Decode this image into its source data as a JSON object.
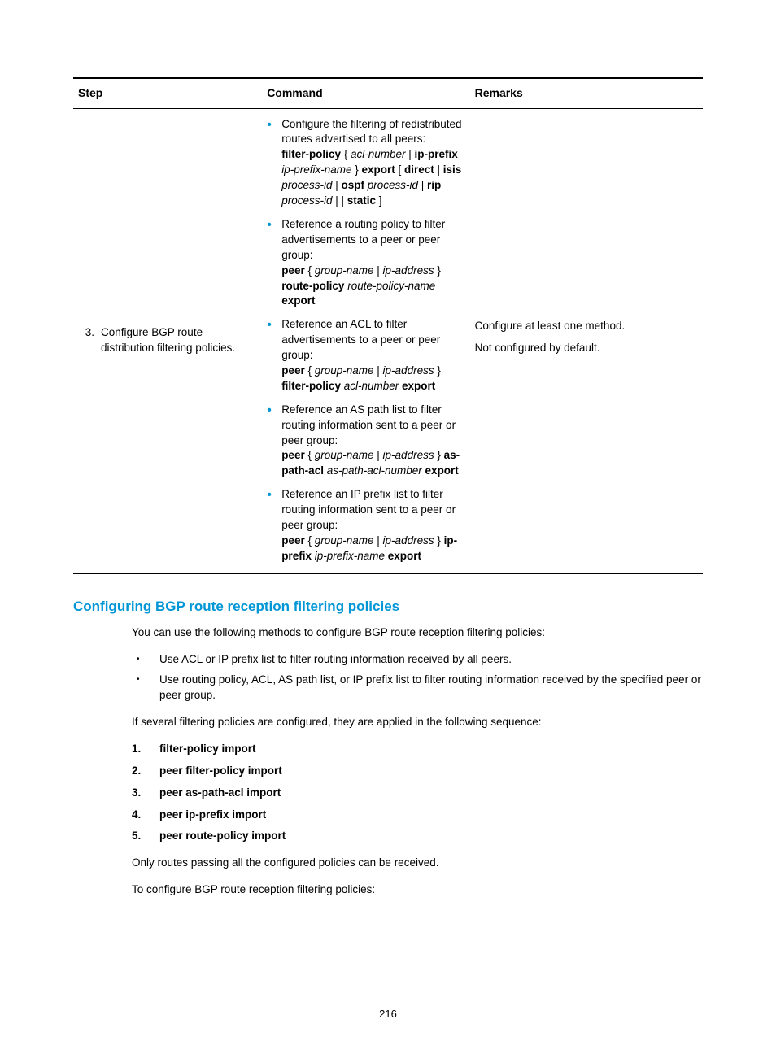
{
  "table": {
    "headers": {
      "step": "Step",
      "command": "Command",
      "remarks": "Remarks"
    },
    "row": {
      "num": "3.",
      "step": "Configure BGP route distribution filtering policies.",
      "commands": [
        {
          "intro": "Configure the filtering of redistributed routes advertised to all peers:",
          "syntax_html": "<span class=\"b\">filter-policy</span> { <span class=\"i\">acl-number</span> | <span class=\"b\">ip-prefix</span> <span class=\"i\">ip-prefix-name</span> } <span class=\"b\">export</span> [ <span class=\"b\">direct</span> | <span class=\"b\">isis</span> <span class=\"i\">process-id</span> | <span class=\"b\">ospf</span> <span class=\"i\">process-id</span> | <span class=\"b\">rip</span> <span class=\"i\">process-id</span> |  | <span class=\"b\">static</span> ]"
        },
        {
          "intro": "Reference a routing policy to filter advertisements to a peer or peer group:",
          "syntax_html": "<span class=\"b\">peer</span> { <span class=\"i\">group-name</span> | <span class=\"i\">ip-address</span> } <span class=\"b\">route-policy</span> <span class=\"i\">route-policy-name</span> <span class=\"b\">export</span>"
        },
        {
          "intro": "Reference an ACL to filter advertisements to a peer or peer group:",
          "syntax_html": "<span class=\"b\">peer</span> { <span class=\"i\">group-name</span> | <span class=\"i\">ip-address</span> } <span class=\"b\">filter-policy</span> <span class=\"i\">acl-number</span> <span class=\"b\">export</span>"
        },
        {
          "intro": "Reference an AS path list to filter routing information sent to a peer or peer group:",
          "syntax_html": "<span class=\"b\">peer</span> { <span class=\"i\">group-name</span> | <span class=\"i\">ip-address</span> } <span class=\"b\">as-path-acl</span> <span class=\"i\">as-path-acl-number</span> <span class=\"b\">export</span>"
        },
        {
          "intro": "Reference an IP prefix list to filter routing information sent to a peer or peer group:",
          "syntax_html": "<span class=\"b\">peer</span> { <span class=\"i\">group-name</span> | <span class=\"i\">ip-address</span> } <span class=\"b\">ip-prefix</span> <span class=\"i\">ip-prefix-name</span> <span class=\"b\">export</span>"
        }
      ],
      "remarks": [
        "Configure at least one method.",
        "Not configured by default."
      ]
    }
  },
  "section": {
    "title": "Configuring BGP route reception filtering policies",
    "p1": "You can use the following methods to configure BGP route reception filtering policies:",
    "bullets": [
      "Use ACL or IP prefix list to filter routing information received by all peers.",
      "Use routing policy, ACL, AS path list, or IP prefix list to filter routing information received by the specified peer or peer group."
    ],
    "p2": "If several filtering policies are configured, they are applied in the following sequence:",
    "ol": [
      "filter-policy import",
      "peer filter-policy import",
      "peer as-path-acl import",
      "peer ip-prefix import",
      "peer route-policy import"
    ],
    "p3": "Only routes passing all the configured policies can be received.",
    "p4": "To configure BGP route reception filtering policies:"
  },
  "page_number": "216"
}
